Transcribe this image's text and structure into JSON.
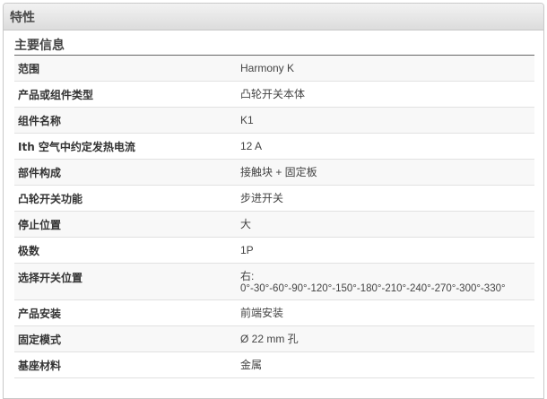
{
  "header": {
    "title": "特性"
  },
  "section": {
    "title": "主要信息"
  },
  "rows": [
    {
      "label": "范围",
      "value": "Harmony K"
    },
    {
      "label": "产品或组件类型",
      "value": "凸轮开关本体"
    },
    {
      "label": "组件名称",
      "value": "K1"
    },
    {
      "label": "Ith 空气中约定发热电流",
      "value": "12 A"
    },
    {
      "label": "部件构成",
      "value": "接触块 + 固定板"
    },
    {
      "label": "凸轮开关功能",
      "value": "步进开关"
    },
    {
      "label": "停止位置",
      "value": "大"
    },
    {
      "label": "极数",
      "value": "1P"
    },
    {
      "label": "选择开关位置",
      "value": "右:",
      "value2": "0°-30°-60°-90°-120°-150°-180°-210°-240°-270°-300°-330°"
    },
    {
      "label": "产品安装",
      "value": "前端安装"
    },
    {
      "label": "固定模式",
      "value": "Ø 22 mm 孔"
    },
    {
      "label": "基座材料",
      "value": "金属"
    }
  ]
}
